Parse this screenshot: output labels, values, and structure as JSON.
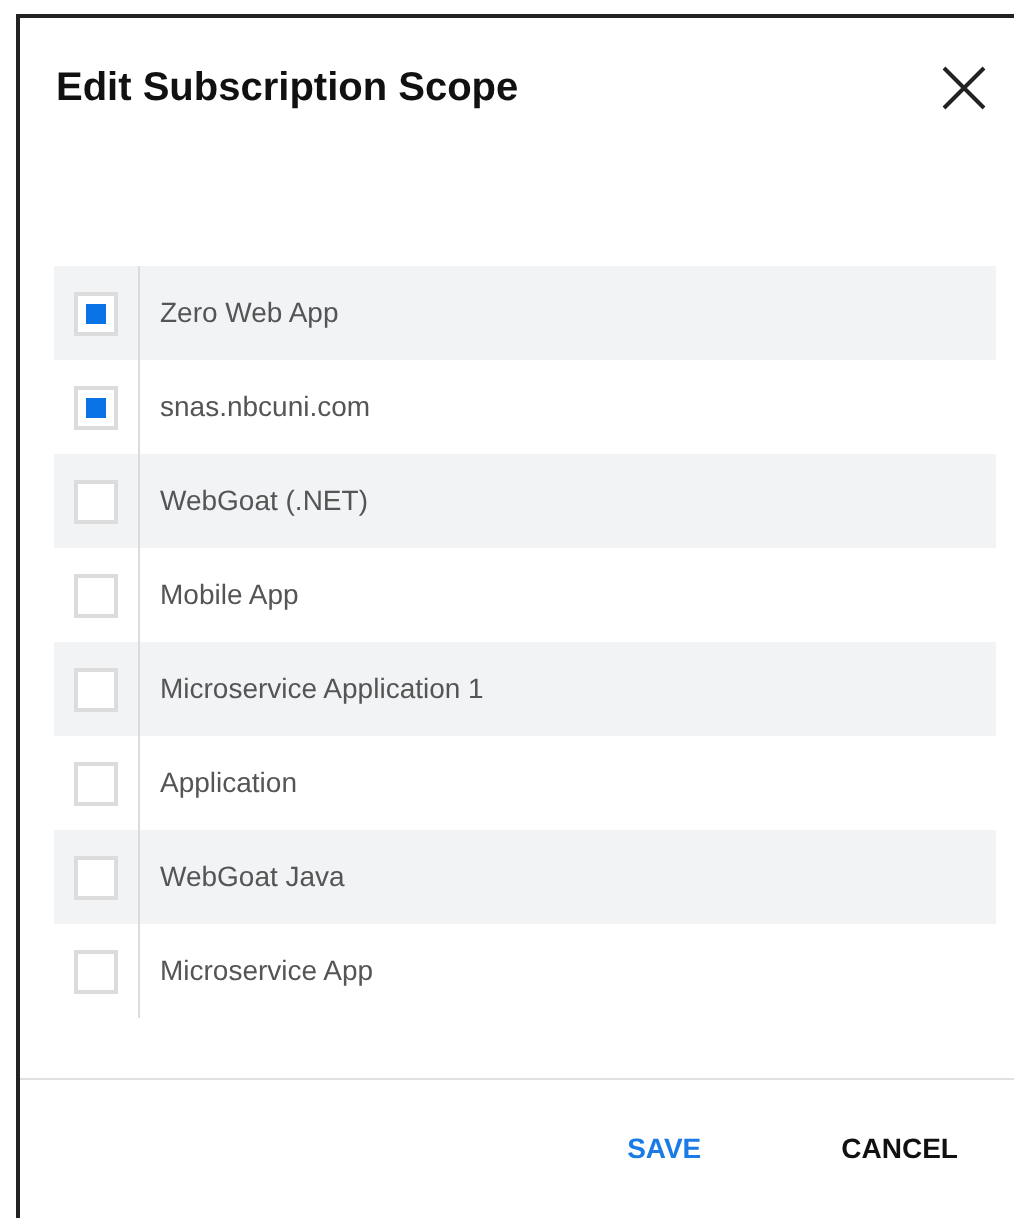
{
  "dialog": {
    "title": "Edit Subscription Scope"
  },
  "items": [
    {
      "label": "Zero Web App",
      "checked": true
    },
    {
      "label": "snas.nbcuni.com",
      "checked": true
    },
    {
      "label": "WebGoat (.NET)",
      "checked": false
    },
    {
      "label": "Mobile App",
      "checked": false
    },
    {
      "label": "Microservice Application 1",
      "checked": false
    },
    {
      "label": "Application",
      "checked": false
    },
    {
      "label": "WebGoat Java",
      "checked": false
    },
    {
      "label": "Microservice App",
      "checked": false
    }
  ],
  "buttons": [
    {
      "label": "SAVE",
      "kind": "primary"
    },
    {
      "label": "CANCEL",
      "kind": "secondary"
    }
  ]
}
